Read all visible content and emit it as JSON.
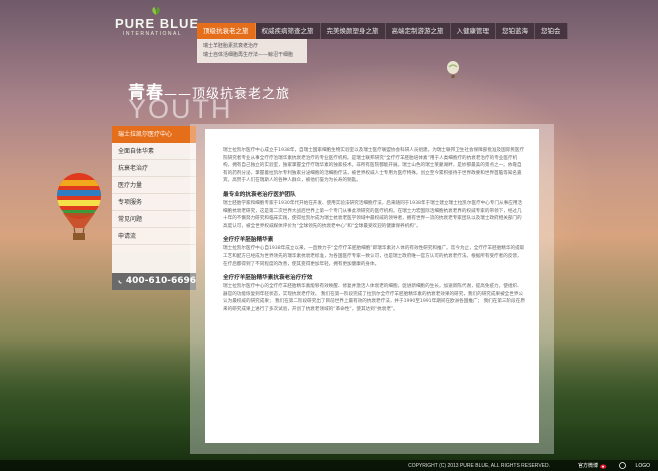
{
  "header": {
    "logo_text": "PURE BLUE",
    "logo_sub": "INTERNATIONAL",
    "nav": [
      {
        "label": "顶级抗衰老之旅",
        "active": true
      },
      {
        "label": "权威疾病筛查之旅",
        "active": false
      },
      {
        "label": "完美焕颜塑身之旅",
        "active": false
      },
      {
        "label": "高端定制游游之旅",
        "active": false
      },
      {
        "label": "入健康管理",
        "active": false
      },
      {
        "label": "您铂蓝海",
        "active": false
      },
      {
        "label": "您铂会",
        "active": false
      }
    ],
    "dropdown": [
      "瑞士羊胚胎素抗衰老治疗",
      "瑞士自体活细胞再生疗法——鲸沼干细胞"
    ]
  },
  "heading": {
    "cn_bold": "青春",
    "cn_rest": "——顶级抗衰老之旅",
    "en": "YOUTH"
  },
  "sidebar": {
    "items": [
      {
        "label": "瑞士拉凯尔医疗中心",
        "active": true
      },
      {
        "label": "全面自体华素",
        "active": false
      },
      {
        "label": "抗衰老治疗",
        "active": false
      },
      {
        "label": "医疗力量",
        "active": false
      },
      {
        "label": "专项服务",
        "active": false
      },
      {
        "label": "常见问题",
        "active": false
      },
      {
        "label": "申请流",
        "active": false
      }
    ],
    "phone": "400-610-6696"
  },
  "content": {
    "intro": "瑞士拉凯尔医疗中心成立于1938年，自瑞士国家细胞生物实验室以及瑞士医疗联盟协会科研人员组建。为瑞士联邦卫生社会保障部批准及国际民医疗院研究者专业从事全疗疗治瑞华素抗衰老治疗的专业医疗机构。是瑞士联邦研究“全疗疗羊胚胎培体素”用于人类细胞疗的抗衰老治疗的专业医疗机构，拥有自己独立的实验室，独家掌握全疗疗瑞华素的独家技术。非所有医院都能开展。瑞士山色的瑞士莱蒙湖畔，是妙那最美的景点之一。依靠自有的药剂分泌，掌握着拉凯尔专利独家分泌细胞的活细胞疗法，被世界权威人士专用为医疗特殊。创立至今累积接待于世界政要和世界首脑等知名嘉宾，高赞于人们在瑞斯人的各种人群众，被他们誉为为长寿的钥匙。",
    "sections": [
      {
        "title": "最专业的抗衰老治疗医护团队",
        "body": "瑞士胚胎学家和细胞专家于1930年代开始在开发、使用实验法研究活细胞疗法，后来随同于1938年于瑞士建立瑞士拉凯尔医疗中心专门从事应用活细胞抗衰老研究，这是第二次世界大战后世界上第一个专门从事此项研究的医疗机构。在瑞士力宏国际活细胞抗衰老界的权威专家的带领下，经过几十年的不懈努力研究和临床实践，使得拉凯尔成为瑞士抗衰老医学领域中最权威的领导者，拥有世界一流的抗衰老专家团队以及瑞士政府相关部门的高度认可，被全世界权威媒体评价为“全球领先的抗衰老中心”和“全球最受欢迎的健康保养机构”。"
      },
      {
        "title": "全疗疗羊胚胎精华素",
        "body": "瑞士拉凯尔医疗中心自1938年成立以来，一直致力于“全疗疗羊胚胎细胞”即瑞华素对人体的有效性研究和推广。迄今为止，全疗疗羊胚胎精华的提取工艺和配方已经成为世界领先的瑞华素抗衰老标准，为各国医疗专家一致认可，也是瑞士政府唯一官方认可的抗衰老疗法。根据所有受疗者的反馈，在疗后都得到了不同程度的改善，使其变得更加年轻，拥有更加健康的身体。"
      },
      {
        "title": "全疗疗羊胚胎精华素抗衰老治疗疗效",
        "body": "瑞士拉凯尔医疗中心的全疗疗羊胚胎精华素能够有效唤醒、修复并激活人体衰老的细胞，促进新细胞的生长，加速新陈代谢，提高免疫力，使组织、器官的功能恢复到年轻状态，实现抗衰老疗效。 我们在第一阶段完成了拉凯尔全疗疗羊胚胎精华素的抗衰老效果的研究，我们的研究成果被全世界公认为最权威的研究成果； 我们在第二阶段研究出了目前世界上最有效的抗衰老疗法，并于1990至1991年期间在欧洲各国推广； 我们在第三阶段在原来的研究成果上进行了多次试验，开创了抗衰老领域的“革命性”，使其达到“抗衰老”。"
      }
    ]
  },
  "footer": {
    "copyright": "COPYRIGHT (C) 2013 PURE BLUE, ALL RIGHTS RESERVED.",
    "weibo": "官方微博",
    "brand": "LOGO"
  },
  "colors": {
    "accent": "#e56e1b",
    "nav_bg": "#3c2d37",
    "phone_bg": "#6a6a6a"
  }
}
